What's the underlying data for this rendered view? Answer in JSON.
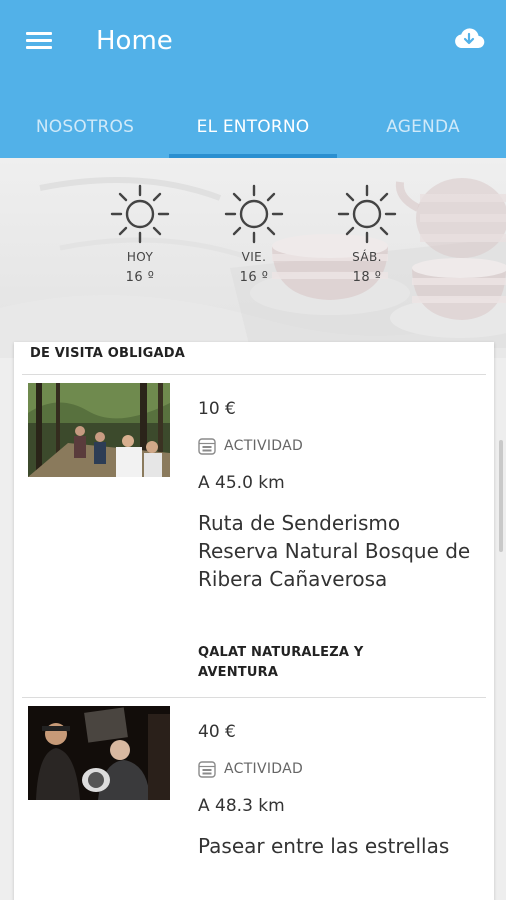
{
  "appbar": {
    "title": "Home",
    "menu_icon": "menu-icon",
    "download_icon": "cloud-download-icon",
    "color": "#52b1e8"
  },
  "tabs": [
    {
      "label": "NOSOTROS",
      "active": false
    },
    {
      "label": "EL ENTORNO",
      "active": true
    },
    {
      "label": "AGENDA",
      "active": false
    }
  ],
  "weather": [
    {
      "day": "HOY",
      "temp": "16 º",
      "icon": "sun-icon"
    },
    {
      "day": "VIE.",
      "temp": "16 º",
      "icon": "sun-icon"
    },
    {
      "day": "SÁB.",
      "temp": "18 º",
      "icon": "sun-icon"
    }
  ],
  "section": {
    "title": "DE VISITA OBLIGADA",
    "items": [
      {
        "price": "10 €",
        "type_icon": "calendar-icon",
        "type": "ACTIVIDAD",
        "distance": "A 45.0 km",
        "title": "Ruta de Senderismo Reserva Natural Bosque de Ribera Cañaverosa",
        "provider": "QALAT NATURALEZA Y AVENTURA"
      },
      {
        "price": "40 €",
        "type_icon": "calendar-icon",
        "type": "ACTIVIDAD",
        "distance": "A 48.3 km",
        "title": "Pasear entre las estrellas"
      }
    ]
  }
}
